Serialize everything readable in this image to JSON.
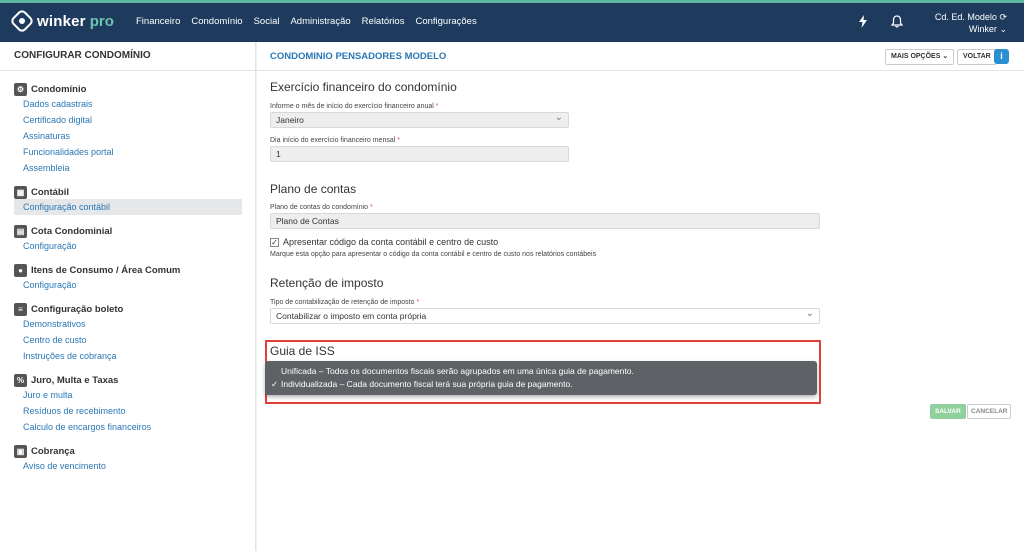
{
  "brand": {
    "name": "winker",
    "suffix": "pro"
  },
  "nav": [
    "Financeiro",
    "Condomínio",
    "Social",
    "Administração",
    "Relatórios",
    "Configurações"
  ],
  "user": {
    "condo": "Cd. Ed. Modelo",
    "name": "Winker"
  },
  "sidebar": {
    "title": "CONFIGURAR CONDOMÍNIO",
    "groups": [
      {
        "label": "Condomínio",
        "icon": "gear-icon",
        "links": [
          "Dados cadastrais",
          "Certificado digital",
          "Assinaturas",
          "Funcionalidades portal",
          "Assembleia"
        ]
      },
      {
        "label": "Contábil",
        "icon": "grid-icon",
        "links": [
          "Configuração contábil"
        ]
      },
      {
        "label": "Cota Condominial",
        "icon": "document-icon",
        "links": [
          "Configuração"
        ]
      },
      {
        "label": "Itens de Consumo / Área Comum",
        "icon": "bulb-icon",
        "links": [
          "Configuração"
        ]
      },
      {
        "label": "Configuração boleto",
        "icon": "list-icon",
        "links": [
          "Demonstrativos",
          "Centro de custo",
          "Instruções de cobrança"
        ]
      },
      {
        "label": "Juro, Multa e Taxas",
        "icon": "percent-icon",
        "links": [
          "Juro e multa",
          "Resíduos de recebimento",
          "Calculo de encargos financeiros"
        ]
      },
      {
        "label": "Cobrança",
        "icon": "calendar-icon",
        "links": [
          "Aviso de vencimento"
        ]
      }
    ]
  },
  "main": {
    "title": "CONDOMINIO PENSADORES MODELO",
    "more_options": "MAIS OPÇÕES",
    "back": "VOLTAR",
    "info": "i",
    "exercicio": {
      "title": "Exercício financeiro do condomínio",
      "month_label": "Informe o mês de início do exercício financeiro anual",
      "month_value": "Janeiro",
      "day_label": "Dia início do exercício financeiro mensal",
      "day_value": "1"
    },
    "plano": {
      "title": "Plano de contas",
      "label": "Plano de contas do condomínio",
      "value": "Plano de Contas",
      "checkbox_label": "Apresentar código da conta contábil e centro de custo",
      "hint": "Marque esta opção para apresentar o código da conta contábil e centro de custo nos relatórios contábeis"
    },
    "retencao": {
      "title": "Retenção de imposto",
      "label": "Tipo de contabilização de retenção de imposto",
      "value": "Contabilizar o imposto em conta própria"
    },
    "iss": {
      "title": "Guia de ISS",
      "options": [
        "Unificada – Todos os documentos fiscais serão agrupados em uma única guia de pagamento.",
        "Individualizada – Cada documento fiscal terá sua própria guia de pagamento."
      ],
      "selected_check": "✓"
    },
    "save": "SALVAR",
    "cancel": "CANCELAR",
    "required_mark": "*"
  }
}
